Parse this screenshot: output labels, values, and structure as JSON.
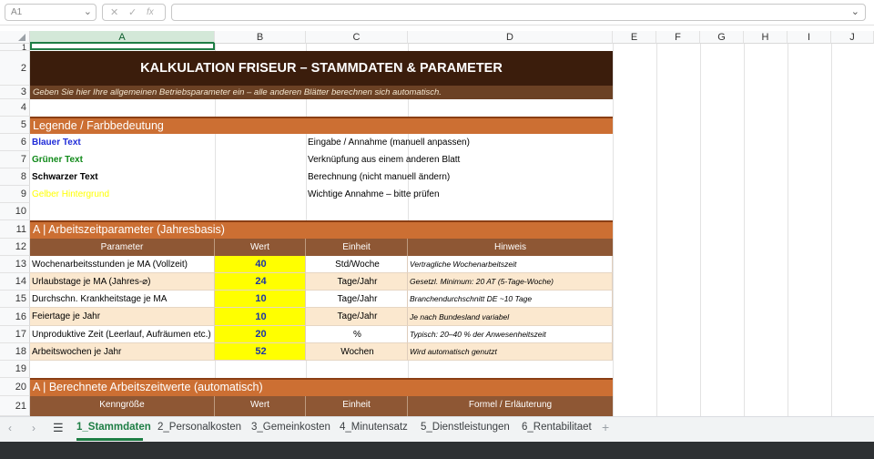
{
  "formula_bar": {
    "cell_ref": "A1",
    "cancel_icon": "✕",
    "accept_icon": "✓",
    "fx_label": "fx",
    "formula": ""
  },
  "columns": [
    "A",
    "B",
    "C",
    "D",
    "E",
    "F",
    "G",
    "H",
    "I",
    "J"
  ],
  "rows": [
    "1",
    "2",
    "3",
    "4",
    "5",
    "6",
    "7",
    "8",
    "9",
    "10",
    "11",
    "12",
    "13",
    "14",
    "15",
    "16",
    "17",
    "18",
    "19",
    "20",
    "21"
  ],
  "title": "KALKULATION FRISEUR – STAMMDATEN & PARAMETER",
  "subtitle": "Geben Sie hier Ihre allgemeinen Betriebsparameter ein – alle anderen Blätter berechnen sich automatisch.",
  "legend": {
    "heading": "Legende / Farbbedeutung",
    "items": [
      {
        "label": "Blauer Text",
        "desc": "Eingabe / Annahme (manuell anpassen)",
        "color": "#1f2bd8"
      },
      {
        "label": "Grüner Text",
        "desc": "Verknüpfung aus einem anderen Blatt",
        "color": "#118a1a"
      },
      {
        "label": "Schwarzer Text",
        "desc": "Berechnung (nicht manuell ändern)",
        "color": "#000000"
      },
      {
        "label": "Gelber Hintergrund",
        "desc": "Wichtige Annahme – bitte prüfen",
        "color": "#ffff00"
      }
    ]
  },
  "section_a": {
    "heading": "A  |  Arbeitszeitparameter (Jahresbasis)",
    "headers": [
      "Parameter",
      "Wert",
      "Einheit",
      "Hinweis"
    ],
    "rows": [
      {
        "param": "Wochenarbeitsstunden je MA (Vollzeit)",
        "value": "40",
        "unit": "Std/Woche",
        "hint": "Vertragliche Wochenarbeitszeit"
      },
      {
        "param": "Urlaubstage je MA (Jahres-⌀)",
        "value": "24",
        "unit": "Tage/Jahr",
        "hint": "Gesetzl. Minimum: 20 AT (5-Tage-Woche)"
      },
      {
        "param": "Durchschn. Krankheitstage je MA",
        "value": "10",
        "unit": "Tage/Jahr",
        "hint": "Branchendurchschnitt DE ~10 Tage"
      },
      {
        "param": "Feiertage je Jahr",
        "value": "10",
        "unit": "Tage/Jahr",
        "hint": "Je nach Bundesland variabel"
      },
      {
        "param": "Unproduktive Zeit (Leerlauf, Aufräumen etc.)",
        "value": "20",
        "unit": "%",
        "hint": "Typisch: 20–40 % der Anwesenheitszeit"
      },
      {
        "param": "Arbeitswochen je Jahr",
        "value": "52",
        "unit": "Wochen",
        "hint": "Wird automatisch genutzt"
      }
    ]
  },
  "section_b": {
    "heading": "A  |  Berechnete Arbeitszeitwerte (automatisch)",
    "headers": [
      "Kenngröße",
      "Wert",
      "Einheit",
      "Formel / Erläuterung"
    ]
  },
  "sheet_tabs": [
    "1_Stammdaten",
    "2_Personalkosten",
    "3_Gemeinkosten",
    "4_Minutensatz",
    "5_Dienstleistungen",
    "6_Rentabilitaet"
  ],
  "add_sheet_icon": "+",
  "menu_icon": "☰",
  "prev_icon": "‹",
  "next_icon": "›"
}
